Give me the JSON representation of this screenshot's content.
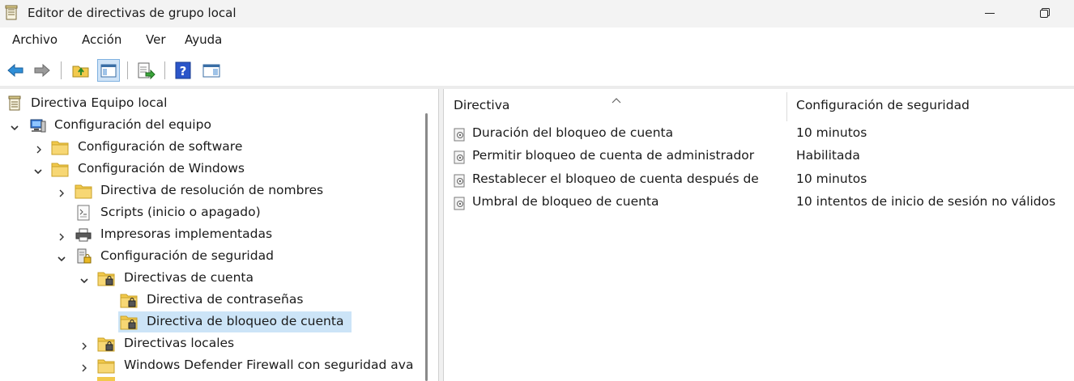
{
  "window": {
    "title": "Editor de directivas de grupo local",
    "icon": "policy-document-icon"
  },
  "menu": [
    "Archivo",
    "Acción",
    "Ver",
    "Ayuda"
  ],
  "toolbar": {
    "buttons": [
      "back-arrow-icon",
      "forward-arrow-icon",
      "up-folder-icon",
      "show-hide-tree-icon",
      "export-list-icon",
      "help-icon",
      "show-hide-action-pane-icon"
    ]
  },
  "tree": {
    "root": "Directiva Equipo local",
    "computer_config": "Configuración del equipo",
    "software_config": "Configuración de software",
    "windows_config": "Configuración de Windows",
    "name_resolution": "Directiva de resolución de nombres",
    "scripts": "Scripts (inicio o apagado)",
    "printers": "Impresoras implementadas",
    "security_config": "Configuración de seguridad",
    "account_policies": "Directivas de cuenta",
    "password_policy": "Directiva de contraseñas",
    "lockout_policy": "Directiva de bloqueo de cuenta",
    "local_policies": "Directivas locales",
    "firewall": "Windows Defender Firewall con seguridad ava"
  },
  "list": {
    "columns": [
      "Directiva",
      "Configuración de seguridad"
    ],
    "rows": [
      {
        "policy": "Duración del bloqueo de cuenta",
        "setting": "10 minutos"
      },
      {
        "policy": "Permitir bloqueo de cuenta de administrador",
        "setting": "Habilitada"
      },
      {
        "policy": "Restablecer el bloqueo de cuenta después de",
        "setting": "10 minutos"
      },
      {
        "policy": "Umbral de bloqueo de cuenta",
        "setting": "10 intentos de inicio de sesión no válidos"
      }
    ]
  },
  "colors": {
    "selection": "#cce4f7",
    "folder": "#f2c94c"
  }
}
